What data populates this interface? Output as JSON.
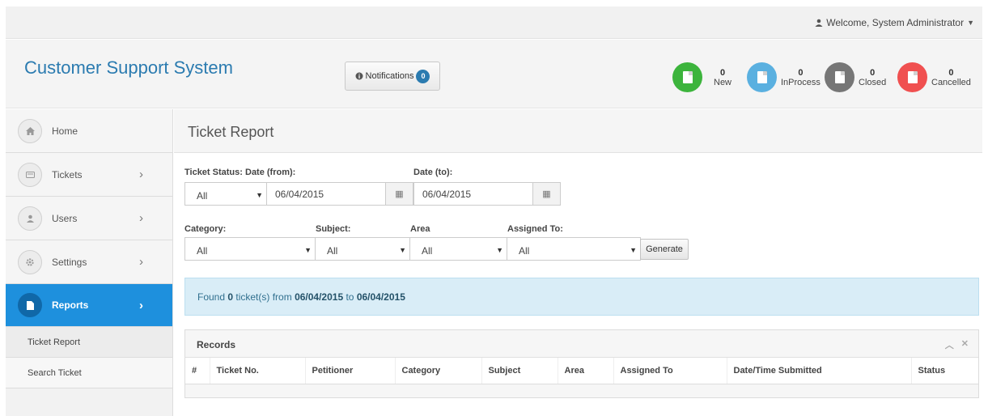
{
  "topbar": {
    "welcome": "Welcome, System Administrator"
  },
  "header": {
    "title": "Customer Support System",
    "notifications_label": "Notifications",
    "notifications_count": "0",
    "stats": [
      {
        "count": "0",
        "label": "New",
        "color": "#3cb43c"
      },
      {
        "count": "0",
        "label": "InProcess",
        "color": "#5ab0e0"
      },
      {
        "count": "0",
        "label": "Closed",
        "color": "#767676"
      },
      {
        "count": "0",
        "label": "Cancelled",
        "color": "#f05050"
      }
    ]
  },
  "sidebar": {
    "items": [
      {
        "label": "Home",
        "icon": "home-icon"
      },
      {
        "label": "Tickets",
        "icon": "ticket-icon"
      },
      {
        "label": "Users",
        "icon": "user-icon"
      },
      {
        "label": "Settings",
        "icon": "gear-icon"
      },
      {
        "label": "Reports",
        "icon": "document-icon"
      }
    ],
    "subitems": [
      {
        "label": "Ticket Report"
      },
      {
        "label": "Search Ticket"
      }
    ]
  },
  "main": {
    "page_title": "Ticket Report",
    "filters": {
      "ticket_status_label": "Ticket Status:",
      "ticket_status_value": "All",
      "date_from_label": "Date (from):",
      "date_from_value": "06/04/2015",
      "date_to_label": "Date (to):",
      "date_to_value": "06/04/2015",
      "category_label": "Category:",
      "category_value": "All",
      "subject_label": "Subject:",
      "subject_value": "All",
      "area_label": "Area",
      "area_value": "All",
      "assigned_label": "Assigned To:",
      "assigned_value": "All",
      "generate_label": "Generate"
    },
    "result": {
      "prefix": "Found ",
      "count": "0",
      "middle": " ticket(s) from ",
      "from": "06/04/2015",
      "to_word": " to ",
      "to": "06/04/2015"
    },
    "records": {
      "title": "Records",
      "columns": [
        "#",
        "Ticket No.",
        "Petitioner",
        "Category",
        "Subject",
        "Area",
        "Assigned To",
        "Date/Time Submitted",
        "Status"
      ]
    }
  }
}
